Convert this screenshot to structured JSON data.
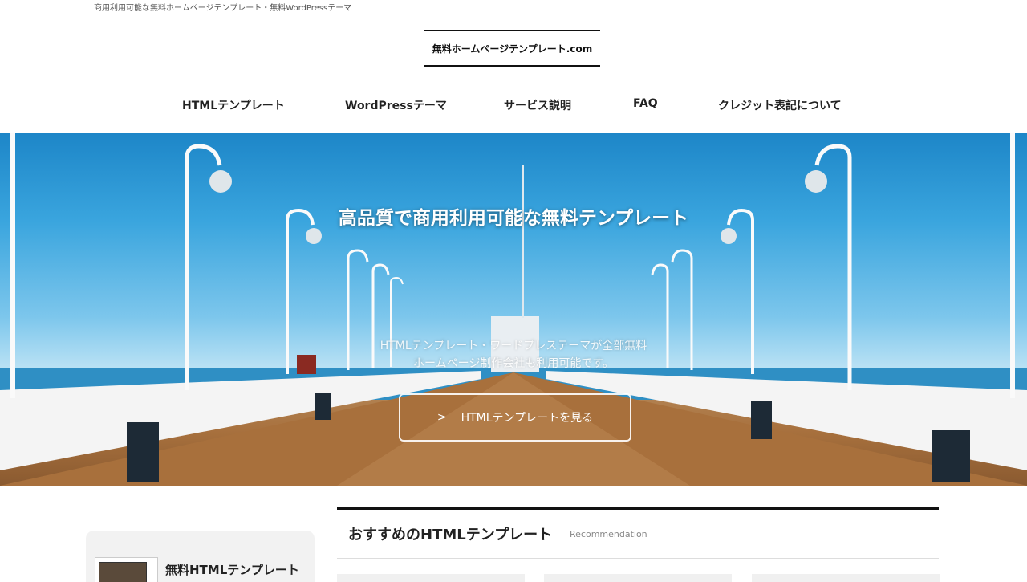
{
  "header": {
    "tagline": "商用利用可能な無料ホームページテンプレート・無料WordPressテーマ",
    "logo_text": "無料ホームページテンプレート.com"
  },
  "nav": {
    "items": [
      {
        "label": "HTMLテンプレート"
      },
      {
        "label": "WordPressテーマ"
      },
      {
        "label": "サービス説明"
      },
      {
        "label": "FAQ"
      },
      {
        "label": "クレジット表記について"
      }
    ]
  },
  "hero": {
    "title": "高品質で商用利用可能な無料テンプレート",
    "subtitle_line1": "HTMLテンプレート・ワードプレステーマが全部無料",
    "subtitle_line2": "ホームページ制作会社も利用可能です。",
    "button_label": "HTMLテンプレートを見る",
    "button_icon": "chevron-right-icon"
  },
  "sidebar": {
    "card_title": "無料HTMLテンプレート"
  },
  "main": {
    "section_title": "おすすめのHTMLテンプレート",
    "section_en": "Recommendation"
  },
  "colors": {
    "text": "#222222",
    "rule": "#111111",
    "sky": "#3aa5de",
    "deck": "#a7703d"
  }
}
